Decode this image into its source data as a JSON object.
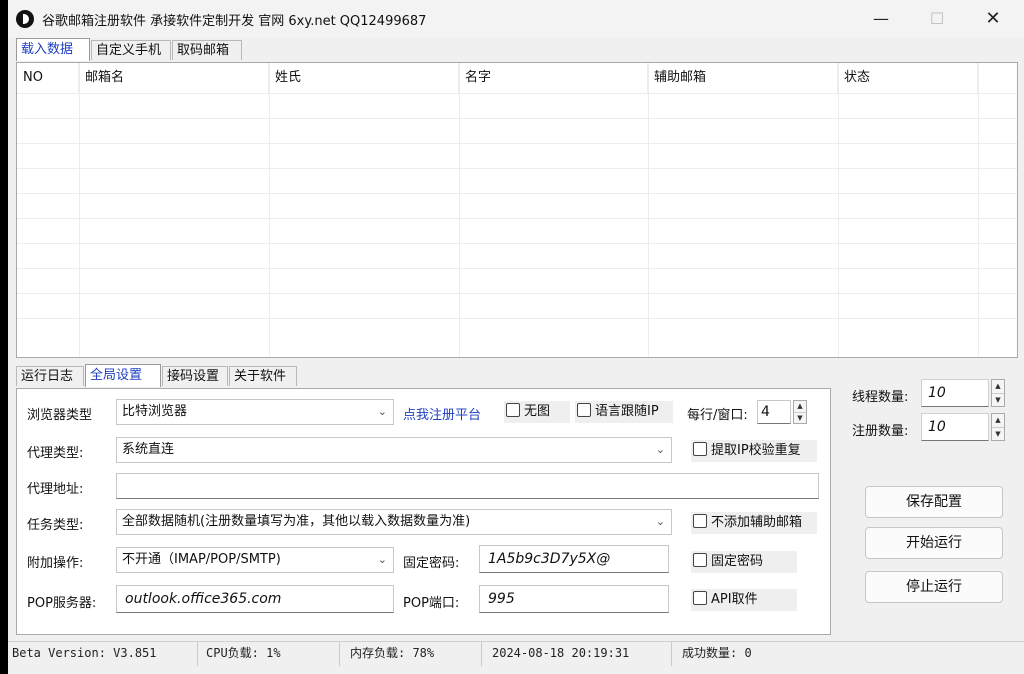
{
  "window": {
    "title": "谷歌邮箱注册软件 承接软件定制开发 官网 6xy.net QQ12499687",
    "minimize": "—",
    "maximize": "☐",
    "close": "✕"
  },
  "top_tabs": [
    "载入数据",
    "自定义手机",
    "取码邮箱"
  ],
  "grid": {
    "columns": [
      "NO",
      "邮箱名",
      "姓氏",
      "名字",
      "辅助邮箱",
      "状态"
    ]
  },
  "bottom_tabs": [
    "运行日志",
    "全局设置",
    "接码设置",
    "关于软件"
  ],
  "settings": {
    "browser_type_label": "浏览器类型",
    "browser_type_value": "比特浏览器",
    "register_link": "点我注册平台",
    "no_image_label": "无图",
    "lang_follow_ip_label": "语言跟随IP",
    "per_row_label": "每行/窗口:",
    "per_row_value": "4",
    "proxy_type_label": "代理类型:",
    "proxy_type_value": "系统直连",
    "fetch_ip_label": "提取IP校验重复",
    "proxy_addr_label": "代理地址:",
    "proxy_addr_value": "",
    "task_type_label": "任务类型:",
    "task_type_value": "全部数据随机(注册数量填写为准，其他以载入数据数量为准)",
    "no_aux_label": "不添加辅助邮箱",
    "extra_op_label": "附加操作:",
    "extra_op_value": "不开通（IMAP/POP/SMTP)",
    "fixed_pw_label": "固定密码:",
    "fixed_pw_value": "1A5b9c3D7y5X@",
    "fixed_pw_check_label": "固定密码",
    "pop_server_label": "POP服务器:",
    "pop_server_value": "outlook.office365.com",
    "pop_port_label": "POP端口:",
    "pop_port_value": "995",
    "api_label": "API取件"
  },
  "side": {
    "threads_label": "线程数量:",
    "threads_value": "10",
    "register_count_label": "注册数量:",
    "register_count_value": "10",
    "save_button": "保存配置",
    "start_button": "开始运行",
    "stop_button": "停止运行"
  },
  "status": {
    "version": "Beta Version: V3.851",
    "cpu": "CPU负载: 1%",
    "memory": "内存负载: 78%",
    "datetime": "2024-08-18 20:19:31",
    "success": "成功数量: 0"
  }
}
